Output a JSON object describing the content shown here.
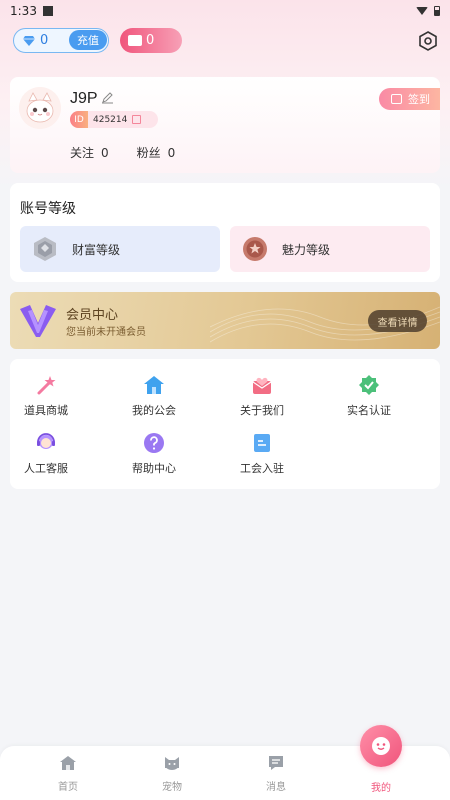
{
  "status_bar": {
    "time": "1:33"
  },
  "header": {
    "diamond_count": "0",
    "recharge_label": "充值",
    "wallet_count": "0"
  },
  "profile": {
    "username": "J9P",
    "id_tag": "ID",
    "id_value": "425214",
    "checkin_label": "签到",
    "follow_label": "关注",
    "follow_count": "0",
    "fans_label": "粉丝",
    "fans_count": "0"
  },
  "account_level": {
    "title": "账号等级",
    "wealth_label": "财富等级",
    "charm_label": "魅力等级"
  },
  "vip": {
    "title": "会员中心",
    "subtitle": "您当前未开通会员",
    "button_label": "查看详情"
  },
  "menu": {
    "items": [
      {
        "label": "道具商城",
        "icon": "magic-wand-icon"
      },
      {
        "label": "我的公会",
        "icon": "house-icon"
      },
      {
        "label": "关于我们",
        "icon": "mail-heart-icon"
      },
      {
        "label": "实名认证",
        "icon": "verified-badge-icon"
      },
      {
        "label": "人工客服",
        "icon": "headset-agent-icon"
      },
      {
        "label": "帮助中心",
        "icon": "help-question-icon"
      },
      {
        "label": "工会入驻",
        "icon": "document-icon"
      }
    ]
  },
  "bottom_nav": {
    "items": [
      {
        "label": "首页",
        "icon": "home-icon"
      },
      {
        "label": "宠物",
        "icon": "pet-cat-icon"
      },
      {
        "label": "消息",
        "icon": "message-icon"
      },
      {
        "label": "我的",
        "icon": "mine-face-icon"
      }
    ],
    "active_index": 3
  },
  "colors": {
    "accent_pink": "#f0557c",
    "diamond_blue": "#4a9cf0",
    "vip_gold": "#e3c894",
    "page_bg": "#f4f5f8"
  }
}
